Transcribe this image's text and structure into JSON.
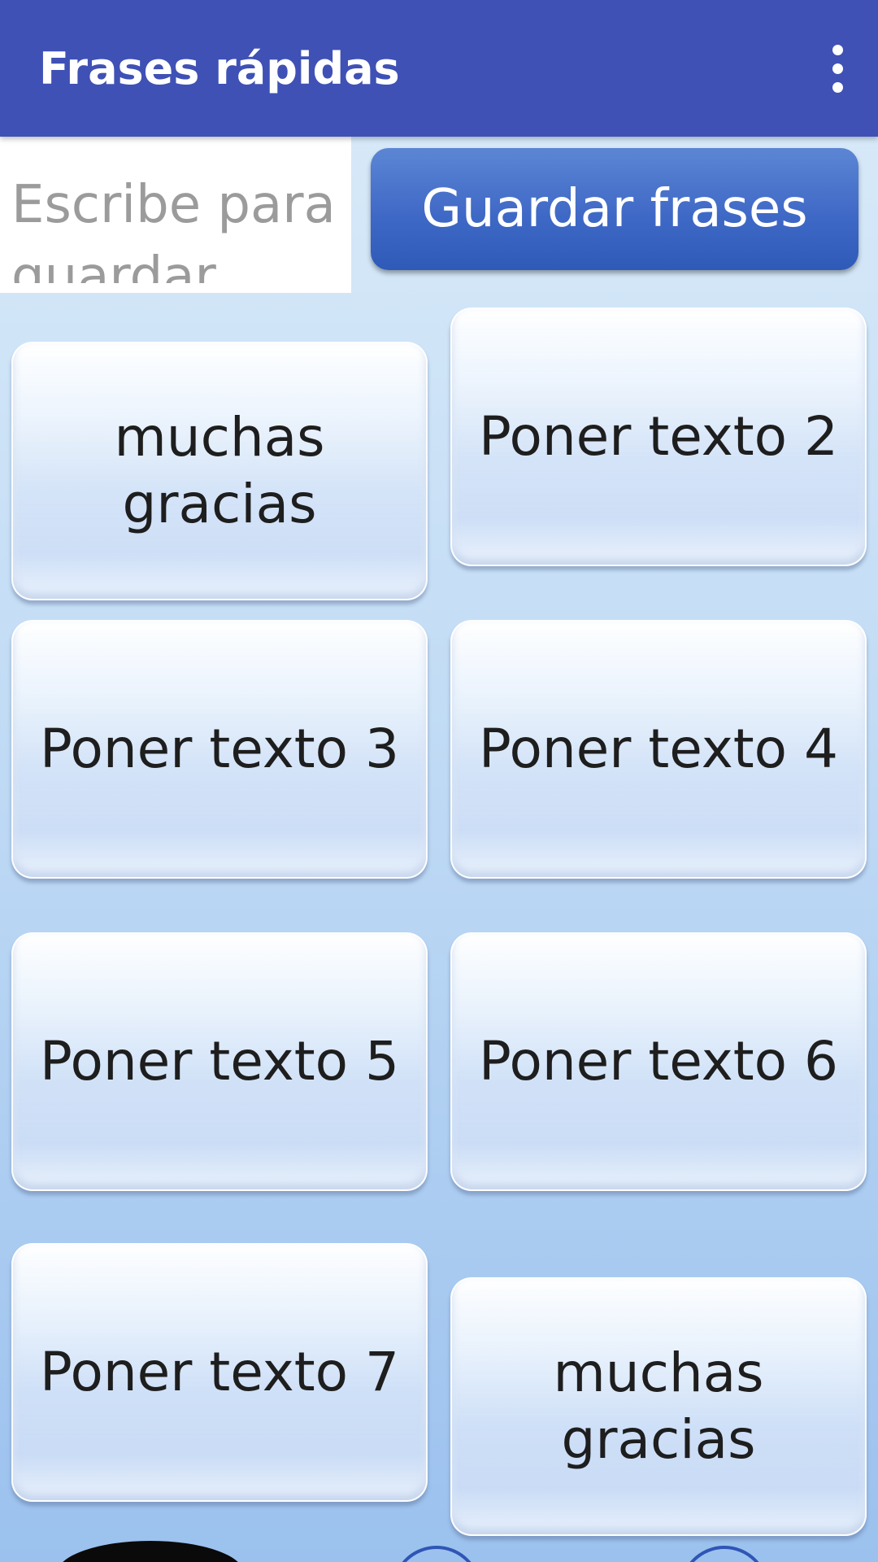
{
  "app_bar": {
    "title": "Frases rápidas",
    "overflow_icon": "more-vert-icon",
    "background": "#3f51b5"
  },
  "phrase_input": {
    "placeholder": "Escribe para guardar",
    "value": ""
  },
  "save_button": {
    "label": "Guardar frases",
    "color": "#3f69c6"
  },
  "phrases": [
    {
      "label": "muchas gracias"
    },
    {
      "label": "Poner texto 2"
    },
    {
      "label": "Poner texto 3"
    },
    {
      "label": "Poner texto 4"
    },
    {
      "label": "Poner texto 5"
    },
    {
      "label": "Poner texto 6"
    },
    {
      "label": "Poner texto 7"
    },
    {
      "label": "muchas gracias"
    }
  ]
}
